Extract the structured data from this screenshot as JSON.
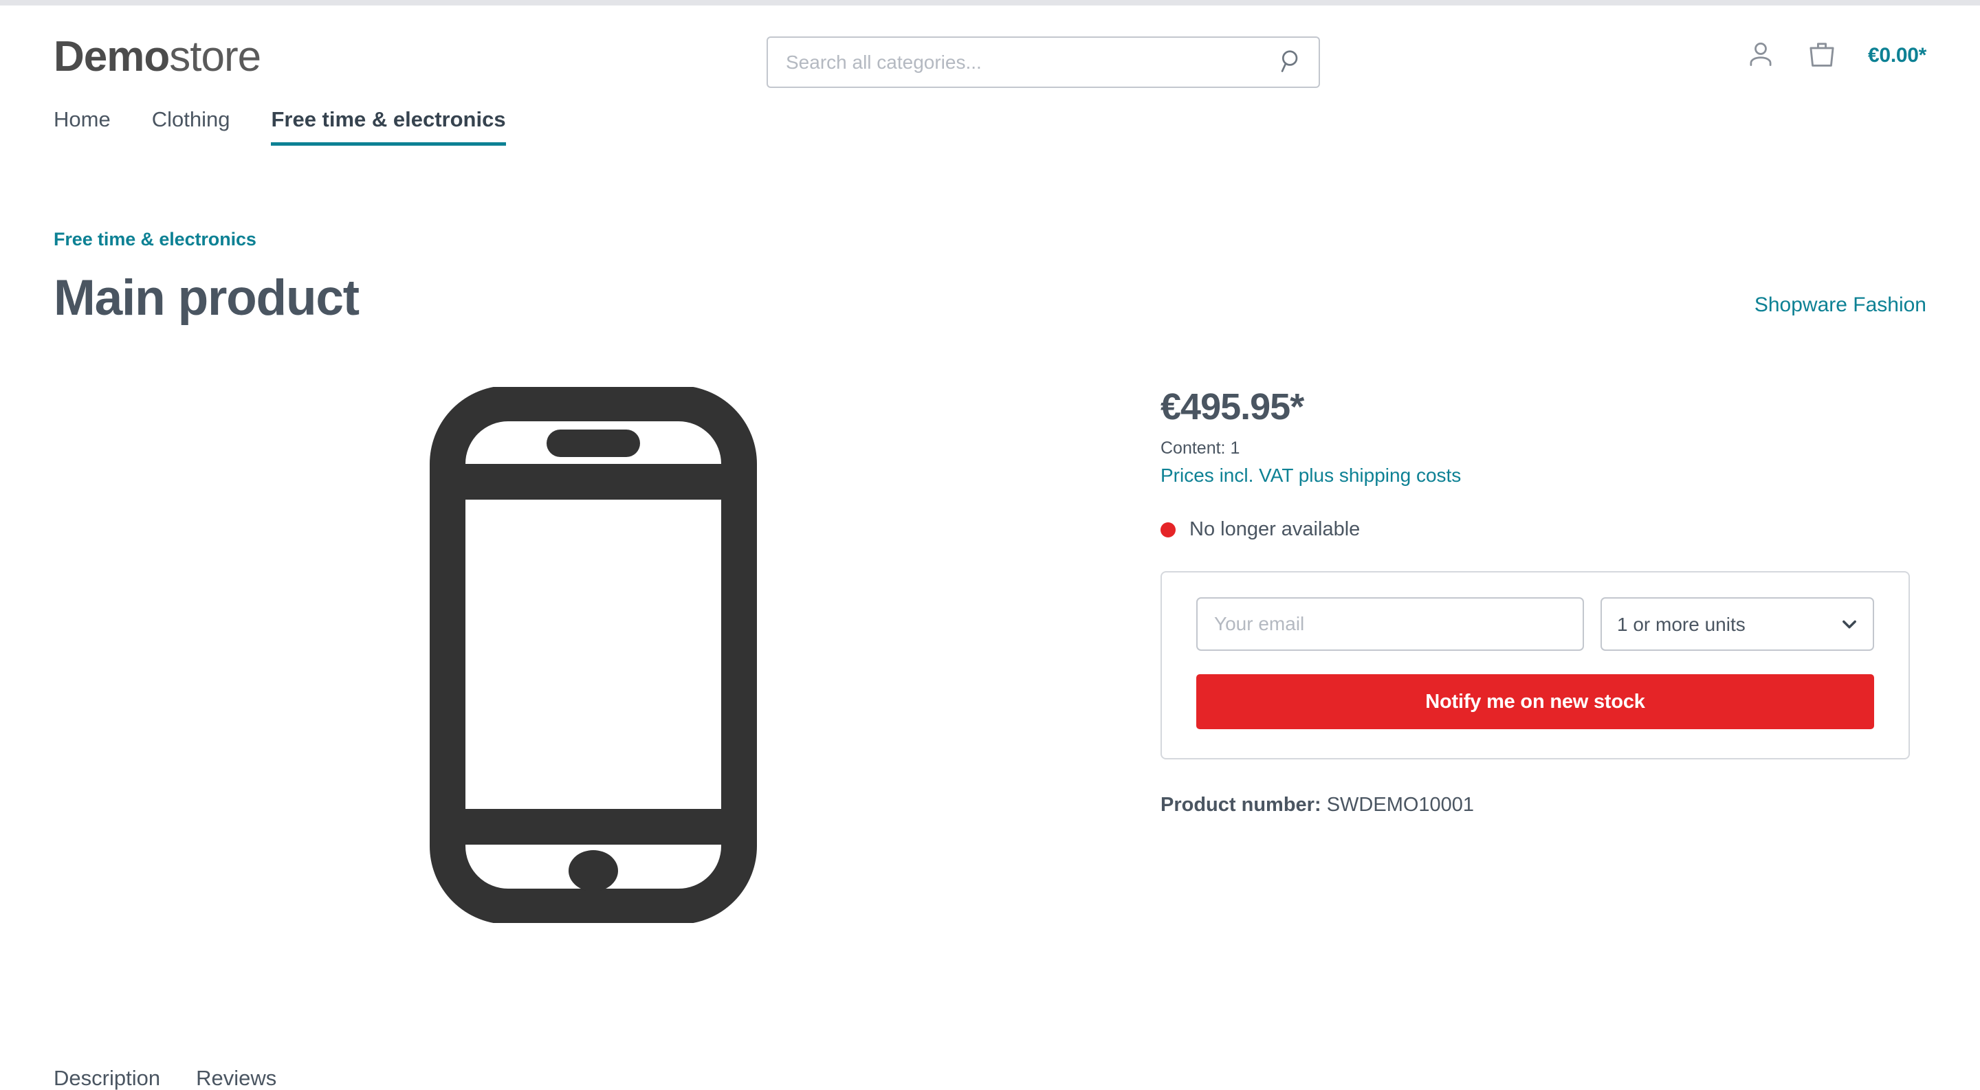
{
  "colors": {
    "accent_teal": "#0d8194",
    "text_dark": "#4a5561",
    "danger_red": "#e52427",
    "border_gray": "#c3c7ce"
  },
  "header": {
    "logo_bold": "Demo",
    "logo_light": "store",
    "search": {
      "placeholder": "Search all categories...",
      "value": "",
      "icon": "search-icon"
    },
    "account_icon": "user-icon",
    "cart_icon": "shopping-bag-icon",
    "cart_total": "€0.00*"
  },
  "nav": {
    "items": [
      {
        "label": "Home",
        "active": false
      },
      {
        "label": "Clothing",
        "active": false
      },
      {
        "label": "Free time & electronics",
        "active": true
      }
    ]
  },
  "product": {
    "breadcrumb": "Free time & electronics",
    "title": "Main product",
    "manufacturer": "Shopware Fashion",
    "gallery_icon": "smartphone-placeholder-icon",
    "price": "€495.95*",
    "content_line": "Content: 1",
    "tax_line": "Prices incl. VAT plus shipping costs",
    "stock_status": "No longer available",
    "notify": {
      "email_placeholder": "Your email",
      "email_value": "",
      "quantity_selected": "1 or more units",
      "quantity_options": [
        "1 or more units"
      ],
      "chevron_icon": "chevron-down-icon",
      "submit_label": "Notify me on new stock"
    },
    "product_number_label": "Product number:",
    "product_number_value": "SWDEMO10001"
  },
  "bottom_tabs": {
    "items": [
      {
        "label": "Description"
      },
      {
        "label": "Reviews"
      }
    ]
  }
}
